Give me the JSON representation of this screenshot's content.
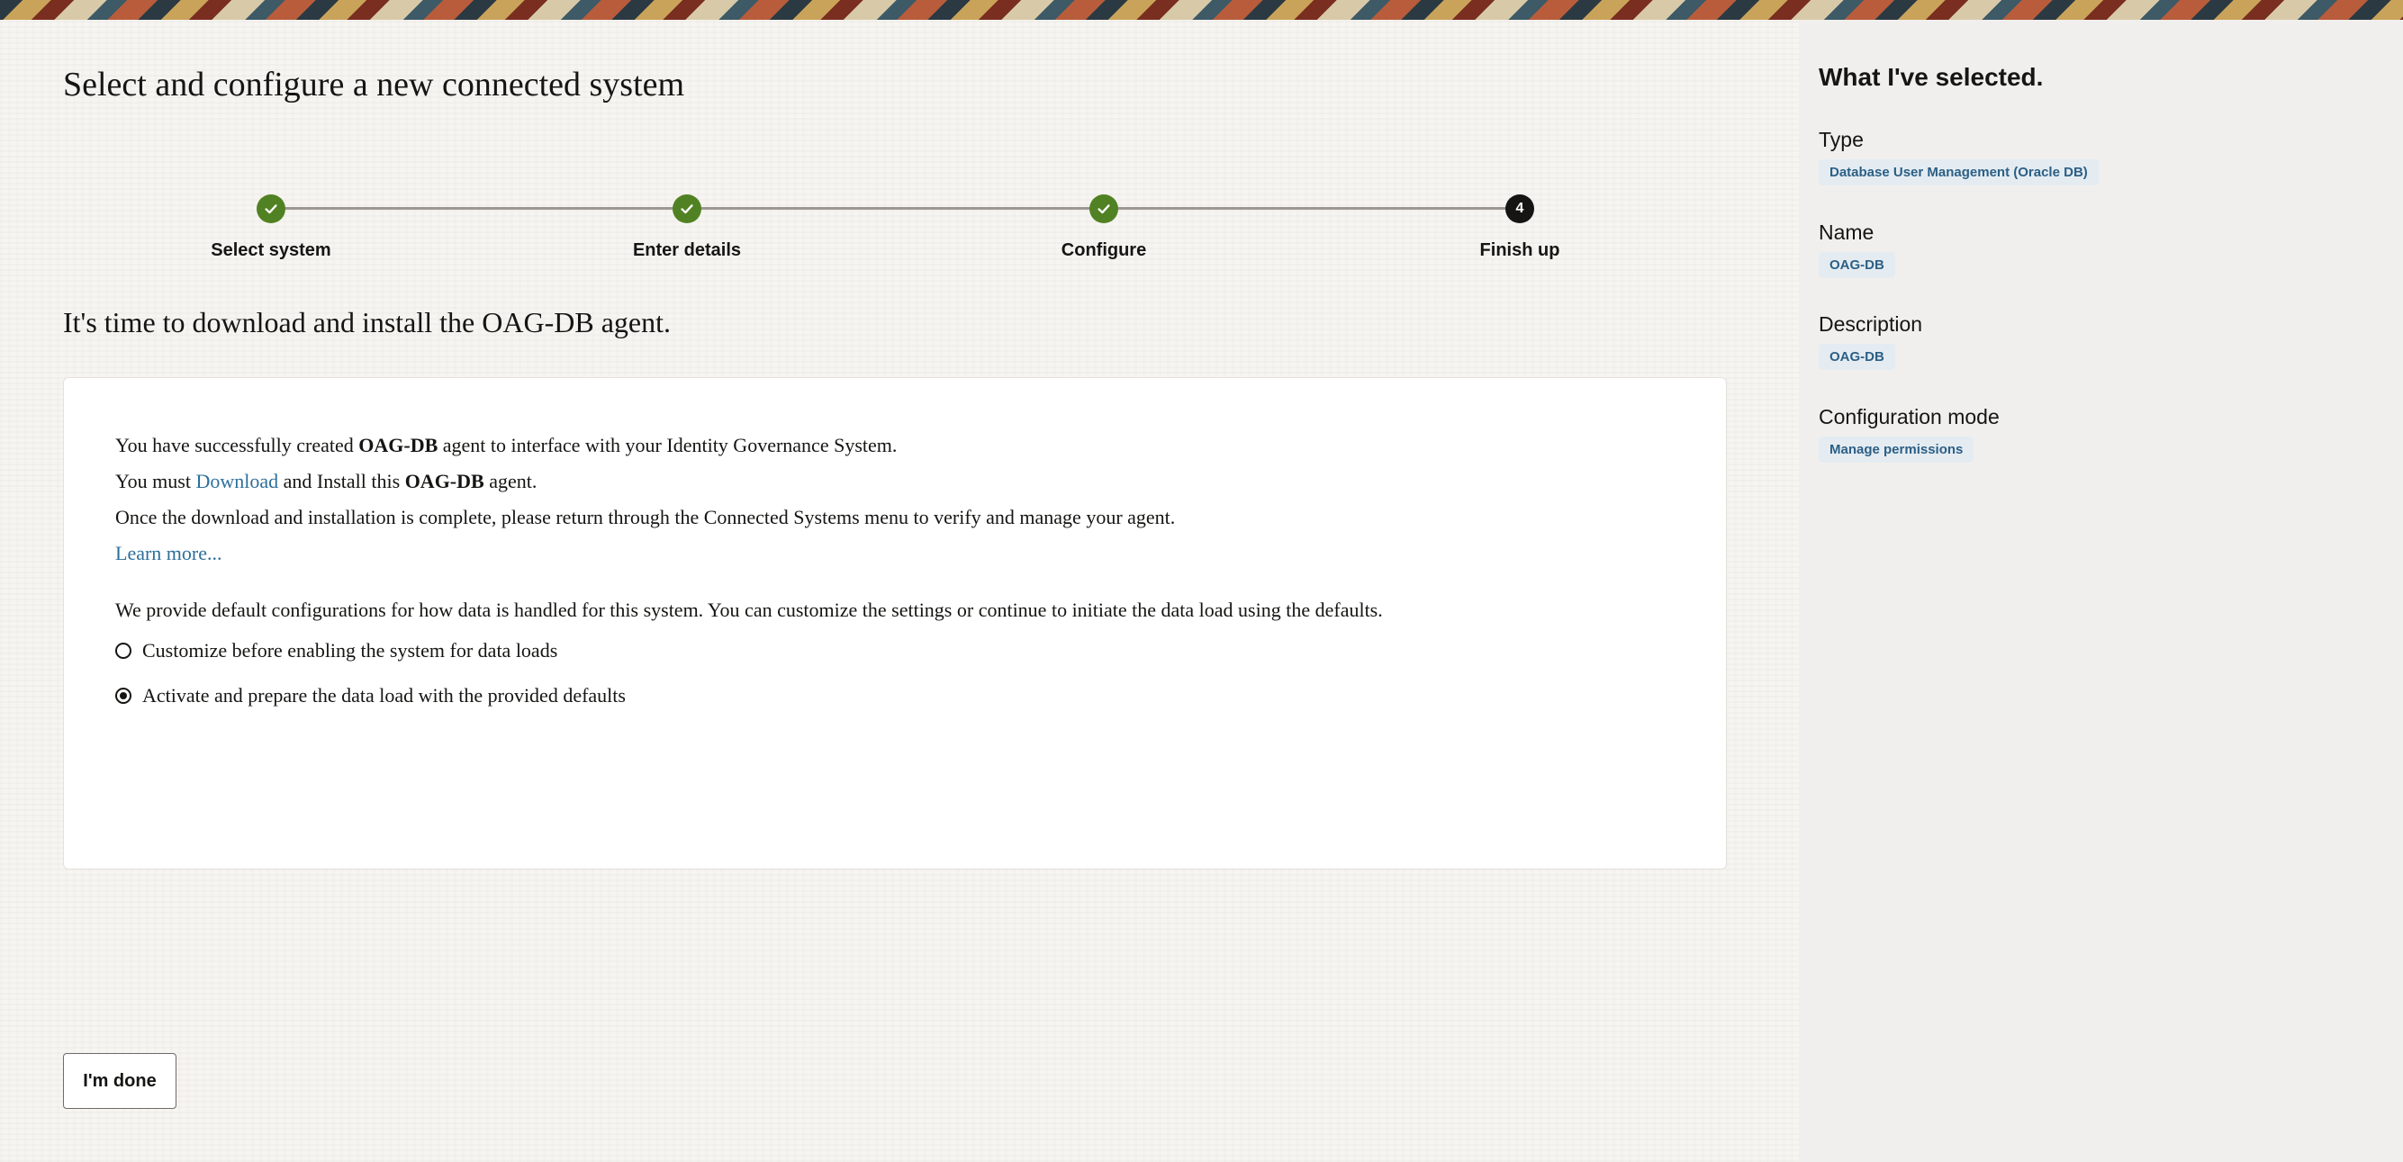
{
  "page": {
    "title": "Select and configure a new connected system"
  },
  "stepper": {
    "steps": [
      {
        "label": "Select system",
        "status": "done"
      },
      {
        "label": "Enter details",
        "status": "done"
      },
      {
        "label": "Configure",
        "status": "done"
      },
      {
        "label": "Finish up",
        "status": "current",
        "number": "4"
      }
    ]
  },
  "main": {
    "subtitle": "It's time to download and install the OAG-DB agent.",
    "line1": {
      "pre": "You have successfully created ",
      "bold": "OAG-DB",
      "post": " agent to interface with your Identity Governance System."
    },
    "line2": {
      "pre": "You must ",
      "link": "Download",
      "mid": " and Install this ",
      "bold": "OAG-DB",
      "post": " agent."
    },
    "line3": "Once the download and installation is complete, please return through the Connected Systems menu to verify and manage your agent.",
    "learn_more": "Learn more...",
    "defaults_text": "We provide default configurations for how data is handled for this system. You can customize the settings or continue to initiate the data load using the defaults.",
    "options": [
      {
        "label": "Customize before enabling the system for data loads",
        "checked": false
      },
      {
        "label": "Activate and prepare the data load with the provided defaults",
        "checked": true
      }
    ],
    "done_button": "I'm done"
  },
  "sidebar": {
    "title": "What I've selected.",
    "items": [
      {
        "label": "Type",
        "value": "Database User Management (Oracle DB)"
      },
      {
        "label": "Name",
        "value": "OAG-DB"
      },
      {
        "label": "Description",
        "value": "OAG-DB"
      },
      {
        "label": "Configuration mode",
        "value": "Manage permissions"
      }
    ]
  },
  "colors": {
    "done_step": "#508223",
    "current_step": "#161513",
    "link": "#2c6f9a",
    "chip_bg": "#e4ecf2",
    "chip_text": "#2c5f85"
  }
}
